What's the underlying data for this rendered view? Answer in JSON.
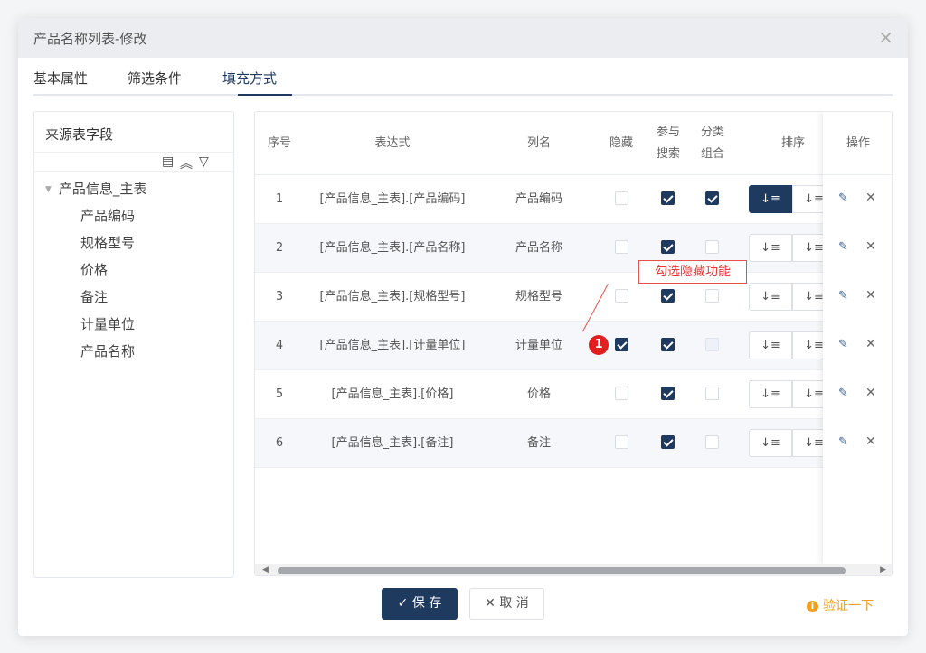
{
  "dialog": {
    "title": "产品名称列表-修改",
    "close": "×"
  },
  "tabs": [
    {
      "label": "基本属性"
    },
    {
      "label": "筛选条件"
    },
    {
      "label": "填充方式"
    }
  ],
  "active_tab": "填充方式",
  "source_panel": {
    "title": "来源表字段",
    "tools": {
      "list": "▤",
      "collapse": "︽",
      "filter": "▽"
    },
    "tree": {
      "caret": "▼",
      "root": "产品信息_主表",
      "children": [
        "产品编码",
        "规格型号",
        "价格",
        "备注",
        "计量单位",
        "产品名称"
      ]
    }
  },
  "grid": {
    "headers": {
      "index": "序号",
      "expression": "表达式",
      "column_name": "列名",
      "hidden": "隐藏",
      "search_1": "参与",
      "search_2": "搜索",
      "group_1": "分类",
      "group_2": "组合",
      "sort": "排序",
      "ops": "操作"
    },
    "sort_asc": "↓≡",
    "sort_desc": "↓≡",
    "op_edit": "✎",
    "op_delete": "✕",
    "rows": [
      {
        "index": "1",
        "expression": "[产品信息_主表].[产品编码]",
        "column_name": "产品编码",
        "hidden": false,
        "search": true,
        "group": true,
        "sort_active": true
      },
      {
        "index": "2",
        "expression": "[产品信息_主表].[产品名称]",
        "column_name": "产品名称",
        "hidden": false,
        "search": true,
        "group": false,
        "sort_active": false
      },
      {
        "index": "3",
        "expression": "[产品信息_主表].[规格型号]",
        "column_name": "规格型号",
        "hidden": false,
        "search": true,
        "group": false,
        "sort_active": false
      },
      {
        "index": "4",
        "expression": "[产品信息_主表].[计量单位]",
        "column_name": "计量单位",
        "hidden": true,
        "search": true,
        "group": false,
        "sort_active": false
      },
      {
        "index": "5",
        "expression": "[产品信息_主表].[价格]",
        "column_name": "价格",
        "hidden": false,
        "search": true,
        "group": false,
        "sort_active": false
      },
      {
        "index": "6",
        "expression": "[产品信息_主表].[备注]",
        "column_name": "备注",
        "hidden": false,
        "search": true,
        "group": false,
        "sort_active": false
      }
    ],
    "scroll": {
      "left": "◀",
      "right": "▶"
    }
  },
  "annotation": {
    "badge": "1",
    "text": "勾选隐藏功能"
  },
  "footer": {
    "save_icon": "✓",
    "save": "保 存",
    "cancel_icon": "✕",
    "cancel": "取 消",
    "verify_icon": "i",
    "verify": "验证一下"
  },
  "colors": {
    "primary": "#1f3a5f",
    "callout": "#e8504a",
    "warning": "#f0a020"
  }
}
